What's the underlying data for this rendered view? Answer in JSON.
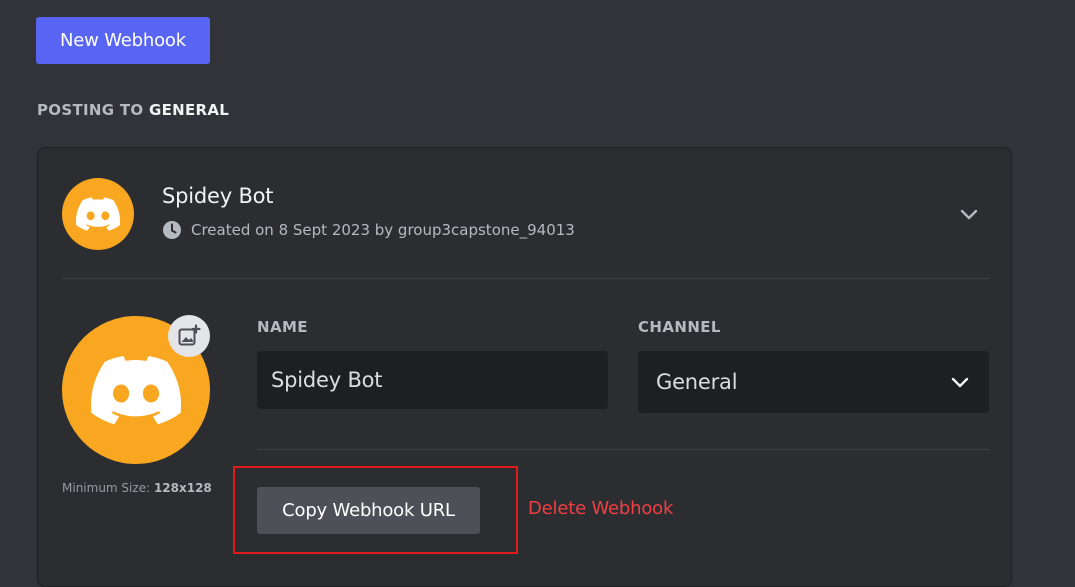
{
  "toolbar": {
    "new_webhook_label": "New Webhook"
  },
  "posting": {
    "prefix": "POSTING TO",
    "channel": "GENERAL"
  },
  "webhook": {
    "name": "Spidey Bot",
    "created_text": "Created on 8 Sept 2023 by group3capstone_94013",
    "avatar_color": "#f9a620",
    "min_size_label": "Minimum Size:",
    "min_size_value": "128x128"
  },
  "form": {
    "name_label": "NAME",
    "name_value": "Spidey Bot",
    "channel_label": "CHANNEL",
    "channel_value": "General"
  },
  "actions": {
    "copy_url_label": "Copy Webhook URL",
    "delete_label": "Delete Webhook"
  },
  "colors": {
    "accent": "#5865f2",
    "danger": "#f23f43",
    "highlight": "#e01b1b",
    "background": "#313338",
    "card": "#2b2d31"
  },
  "icons": {
    "avatar": "discord-logo-icon",
    "clock": "clock-icon",
    "chevron": "chevron-down-icon",
    "upload": "image-add-icon"
  }
}
